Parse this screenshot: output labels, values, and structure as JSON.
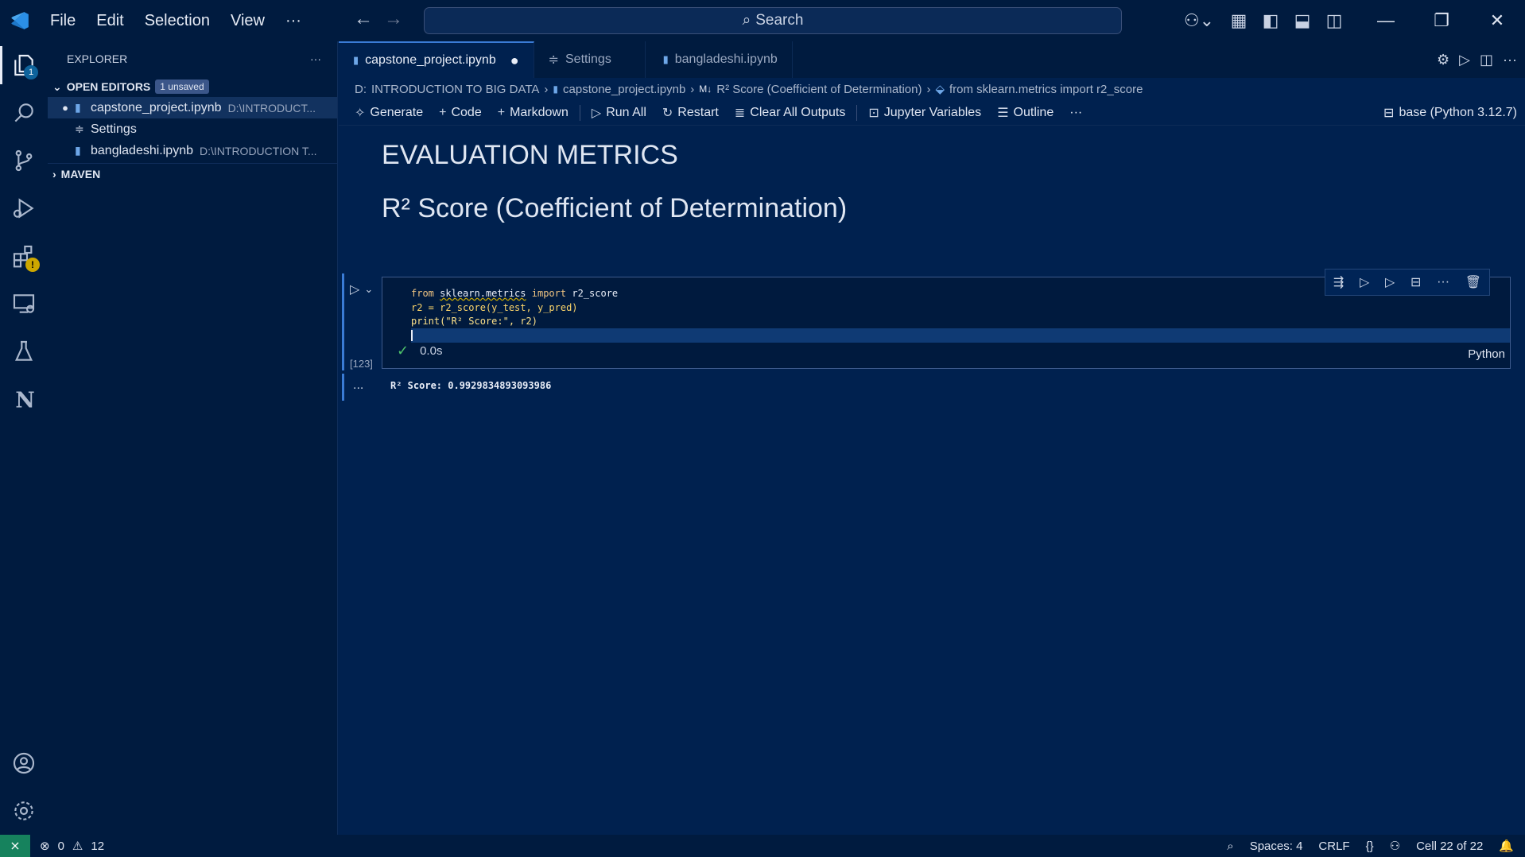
{
  "menu": {
    "file": "File",
    "edit": "Edit",
    "selection": "Selection",
    "view": "View",
    "more": "···"
  },
  "search": {
    "label": "Search"
  },
  "explorer": {
    "title": "EXPLORER",
    "open_editors": "OPEN EDITORS",
    "unsaved_badge": "1 unsaved",
    "files": [
      {
        "name": "capstone_project.ipynb",
        "path": "D:\\INTRODUCT..."
      },
      {
        "name": "Settings",
        "path": ""
      },
      {
        "name": "bangladeshi.ipynb",
        "path": "D:\\INTRODUCTION T..."
      }
    ],
    "maven": "MAVEN"
  },
  "tabs": [
    {
      "label": "capstone_project.ipynb"
    },
    {
      "label": "Settings"
    },
    {
      "label": "bangladeshi.ipynb"
    }
  ],
  "breadcrumb": {
    "drive": "D:",
    "folder": "INTRODUCTION TO BIG DATA",
    "file": "capstone_project.ipynb",
    "md_prefix": "M↓",
    "section": "R² Score (Coefficient of Determination)",
    "symbol": "from sklearn.metrics import r2_score"
  },
  "toolbar": {
    "generate": "Generate",
    "code": "Code",
    "markdown": "Markdown",
    "run_all": "Run All",
    "restart": "Restart",
    "clear": "Clear All Outputs",
    "variables": "Jupyter Variables",
    "outline": "Outline",
    "more": "···",
    "kernel": "base (Python 3.12.7)"
  },
  "notebook": {
    "heading1": "EVALUATION METRICS",
    "heading2": "R² Score (Coefficient of Determination)",
    "exec_count": "[123]",
    "duration": "0.0s",
    "language": "Python",
    "output_prefix": "...",
    "output": "R² Score: 0.9929834893093986"
  },
  "code_lines": {
    "l1_from": "from",
    "l1_mod": "sklearn.metrics",
    "l1_import": "import",
    "l1_name": "r2_score",
    "l2": "r2 = r2_score(y_test, y_pred)",
    "l3": "print(\"R² Score:\", r2)"
  },
  "statusbar": {
    "errors": "0",
    "warnings": "12",
    "spaces": "Spaces: 4",
    "eol": "CRLF",
    "cell": "Cell 22 of 22"
  },
  "activity": {
    "explorer_badge": "1"
  },
  "colors": {
    "background": "#00214f",
    "accent": "#3a7bd5",
    "remote": "#16825d"
  }
}
